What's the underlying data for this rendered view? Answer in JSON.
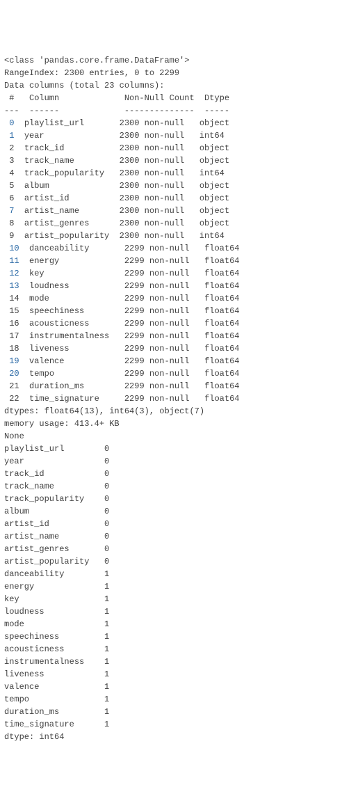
{
  "info": {
    "class_line": "<class 'pandas.core.frame.DataFrame'>",
    "range_line": "RangeIndex: 2300 entries, 0 to 2299",
    "data_cols_line": "Data columns (total 23 columns):",
    "header_line": " #   Column             Non-Null Count  Dtype  ",
    "divider_line": "---  ------             --------------  -----  ",
    "rows": [
      {
        "idx": " 0",
        "col": "playlist_url     ",
        "count": "2300 non-null   ",
        "dtype": "object "
      },
      {
        "idx": " 1",
        "col": "year             ",
        "count": "2300 non-null   ",
        "dtype": "int64  "
      },
      {
        "idx": " 2",
        "col": "track_id         ",
        "count": "2300 non-null   ",
        "dtype": "object "
      },
      {
        "idx": " 3",
        "col": "track_name       ",
        "count": "2300 non-null   ",
        "dtype": "object "
      },
      {
        "idx": " 4",
        "col": "track_popularity ",
        "count": "2300 non-null   ",
        "dtype": "int64  "
      },
      {
        "idx": " 5",
        "col": "album            ",
        "count": "2300 non-null   ",
        "dtype": "object "
      },
      {
        "idx": " 6",
        "col": "artist_id        ",
        "count": "2300 non-null   ",
        "dtype": "object "
      },
      {
        "idx": " 7",
        "col": "artist_name      ",
        "count": "2300 non-null   ",
        "dtype": "object "
      },
      {
        "idx": " 8",
        "col": "artist_genres    ",
        "count": "2300 non-null   ",
        "dtype": "object "
      },
      {
        "idx": " 9",
        "col": "artist_popularity",
        "count": "2300 non-null   ",
        "dtype": "int64  "
      },
      {
        "idx": " 10",
        "col": "danceability     ",
        "count": "2299 non-null   ",
        "dtype": "float64"
      },
      {
        "idx": " 11",
        "col": "energy           ",
        "count": "2299 non-null   ",
        "dtype": "float64"
      },
      {
        "idx": " 12",
        "col": "key              ",
        "count": "2299 non-null   ",
        "dtype": "float64"
      },
      {
        "idx": " 13",
        "col": "loudness         ",
        "count": "2299 non-null   ",
        "dtype": "float64"
      },
      {
        "idx": " 14",
        "col": "mode             ",
        "count": "2299 non-null   ",
        "dtype": "float64"
      },
      {
        "idx": " 15",
        "col": "speechiness      ",
        "count": "2299 non-null   ",
        "dtype": "float64"
      },
      {
        "idx": " 16",
        "col": "acousticness     ",
        "count": "2299 non-null   ",
        "dtype": "float64"
      },
      {
        "idx": " 17",
        "col": "instrumentalness ",
        "count": "2299 non-null   ",
        "dtype": "float64"
      },
      {
        "idx": " 18",
        "col": "liveness         ",
        "count": "2299 non-null   ",
        "dtype": "float64"
      },
      {
        "idx": " 19",
        "col": "valence          ",
        "count": "2299 non-null   ",
        "dtype": "float64"
      },
      {
        "idx": " 20",
        "col": "tempo            ",
        "count": "2299 non-null   ",
        "dtype": "float64"
      },
      {
        "idx": " 21",
        "col": "duration_ms      ",
        "count": "2299 non-null   ",
        "dtype": "float64"
      },
      {
        "idx": " 22",
        "col": "time_signature   ",
        "count": "2299 non-null   ",
        "dtype": "float64"
      }
    ],
    "dtypes_line": "dtypes: float64(13), int64(3), object(7)",
    "memory_line": "memory usage: 413.4+ KB",
    "none_line": "None"
  },
  "nulls": {
    "rows": [
      {
        "name": "playlist_url        ",
        "val": "0"
      },
      {
        "name": "year                ",
        "val": "0"
      },
      {
        "name": "track_id            ",
        "val": "0"
      },
      {
        "name": "track_name          ",
        "val": "0"
      },
      {
        "name": "track_popularity    ",
        "val": "0"
      },
      {
        "name": "album               ",
        "val": "0"
      },
      {
        "name": "artist_id           ",
        "val": "0"
      },
      {
        "name": "artist_name         ",
        "val": "0"
      },
      {
        "name": "artist_genres       ",
        "val": "0"
      },
      {
        "name": "artist_popularity   ",
        "val": "0"
      },
      {
        "name": "danceability        ",
        "val": "1"
      },
      {
        "name": "energy              ",
        "val": "1"
      },
      {
        "name": "key                 ",
        "val": "1"
      },
      {
        "name": "loudness            ",
        "val": "1"
      },
      {
        "name": "mode                ",
        "val": "1"
      },
      {
        "name": "speechiness         ",
        "val": "1"
      },
      {
        "name": "acousticness        ",
        "val": "1"
      },
      {
        "name": "instrumentalness    ",
        "val": "1"
      },
      {
        "name": "liveness            ",
        "val": "1"
      },
      {
        "name": "valence             ",
        "val": "1"
      },
      {
        "name": "tempo               ",
        "val": "1"
      },
      {
        "name": "duration_ms         ",
        "val": "1"
      },
      {
        "name": "time_signature      ",
        "val": "1"
      }
    ],
    "dtype_line": "dtype: int64"
  },
  "blue_rows": [
    0,
    1,
    7,
    10,
    11,
    12,
    13,
    19,
    20
  ]
}
